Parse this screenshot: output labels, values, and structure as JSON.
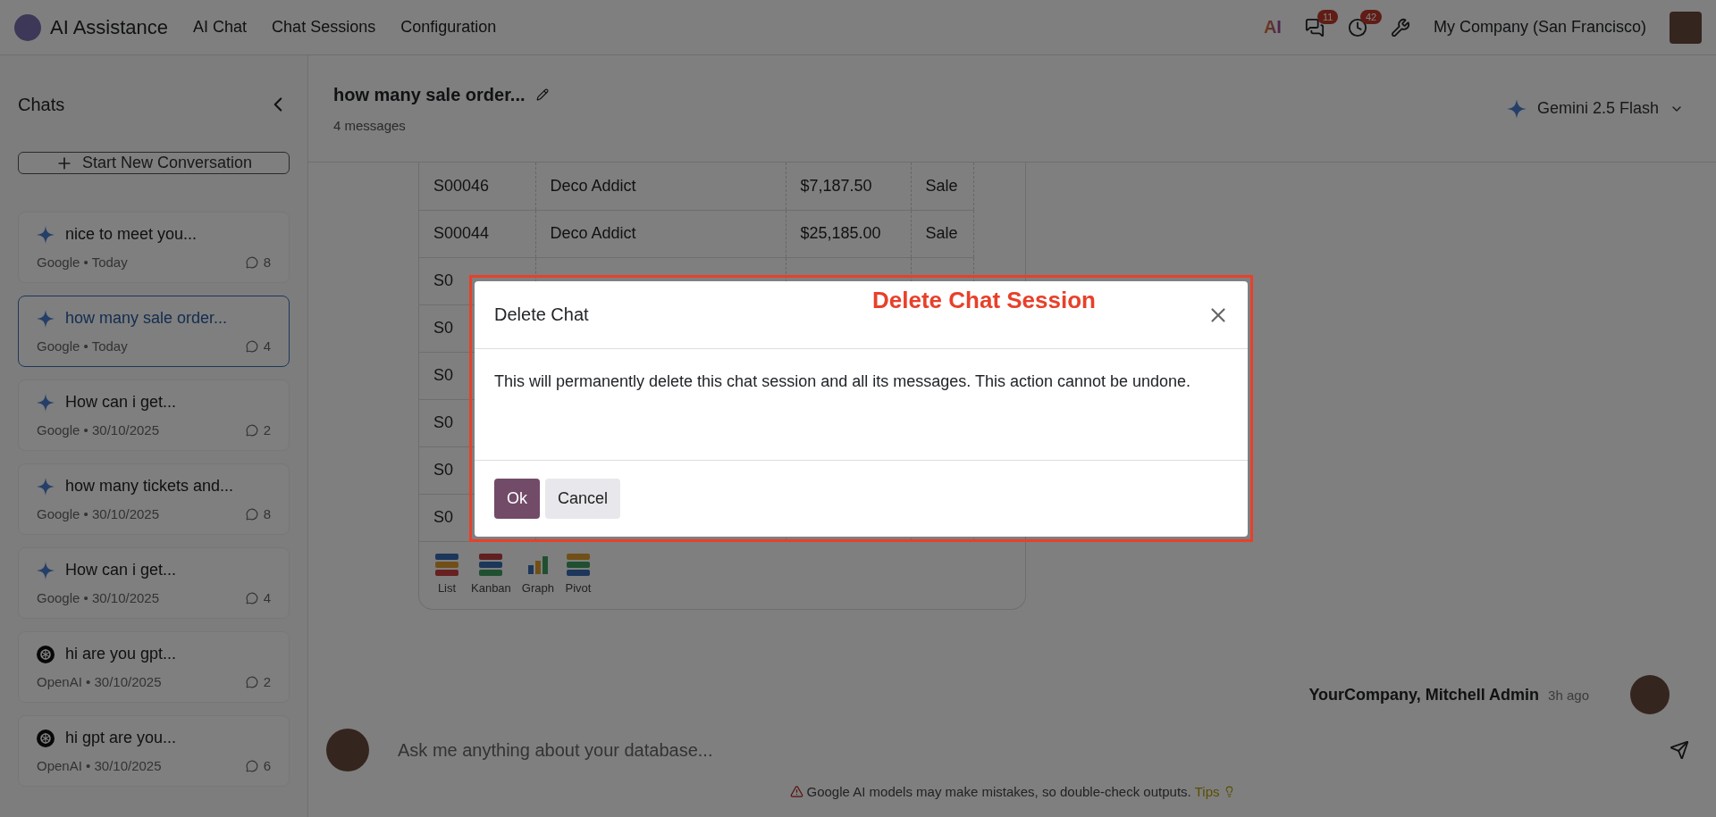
{
  "topbar": {
    "app_name": "AI Assistance",
    "menu": [
      {
        "label": "AI Chat"
      },
      {
        "label": "Chat Sessions"
      },
      {
        "label": "Configuration"
      }
    ],
    "ai_logo": "AI",
    "messages_badge": "11",
    "activities_badge": "42",
    "company": "My Company (San Francisco)"
  },
  "sidebar": {
    "title": "Chats",
    "new_button": "Start New Conversation",
    "items": [
      {
        "title": "nice to meet you...",
        "meta": "Google • Today",
        "kind": "google",
        "count": "8",
        "selected": false
      },
      {
        "title": "how many sale order...",
        "meta": "Google • Today",
        "kind": "google",
        "count": "4",
        "selected": true
      },
      {
        "title": "How can i get...",
        "meta": "Google • 30/10/2025",
        "kind": "google",
        "count": "2",
        "selected": false
      },
      {
        "title": "how many tickets and...",
        "meta": "Google • 30/10/2025",
        "kind": "google",
        "count": "8",
        "selected": false
      },
      {
        "title": "How can i get...",
        "meta": "Google • 30/10/2025",
        "kind": "google",
        "count": "4",
        "selected": false
      },
      {
        "title": "hi are you gpt...",
        "meta": "OpenAI • 30/10/2025",
        "kind": "openai",
        "count": "2",
        "selected": false
      },
      {
        "title": "hi gpt are you...",
        "meta": "OpenAI • 30/10/2025",
        "kind": "openai",
        "count": "6",
        "selected": false
      }
    ]
  },
  "chat": {
    "title": "how many sale order...",
    "subtitle": "4 messages",
    "model": "Gemini 2.5 Flash",
    "table": {
      "rows": [
        [
          "S00046",
          "Deco Addict",
          "$7,187.50",
          "Sale"
        ],
        [
          "S00044",
          "Deco Addict",
          "$25,185.00",
          "Sale"
        ],
        [
          "S0"
        ],
        [
          "S0"
        ],
        [
          "S0"
        ],
        [
          "S0"
        ],
        [
          "S0"
        ],
        [
          "S0"
        ]
      ]
    },
    "views": [
      {
        "label": "List",
        "kind": "list"
      },
      {
        "label": "Kanban",
        "kind": "kanban"
      },
      {
        "label": "Graph",
        "kind": "graph"
      },
      {
        "label": "Pivot",
        "kind": "pivot"
      }
    ],
    "author": "YourCompany, Mitchell Admin",
    "time": "3h ago",
    "input": {
      "placeholder": "Ask me anything about your database..."
    },
    "disclaimer": "Google AI models may make mistakes, so double-check outputs.",
    "tips": "Tips"
  },
  "dialog": {
    "title": "Delete Chat",
    "body": "This will permanently delete this chat session and all its messages. This action cannot be undone.",
    "buttons": [
      {
        "label": "Ok",
        "kind": "primary"
      },
      {
        "label": "Cancel",
        "kind": "secondary"
      }
    ]
  },
  "annotation": {
    "label": "Delete Chat Session"
  }
}
